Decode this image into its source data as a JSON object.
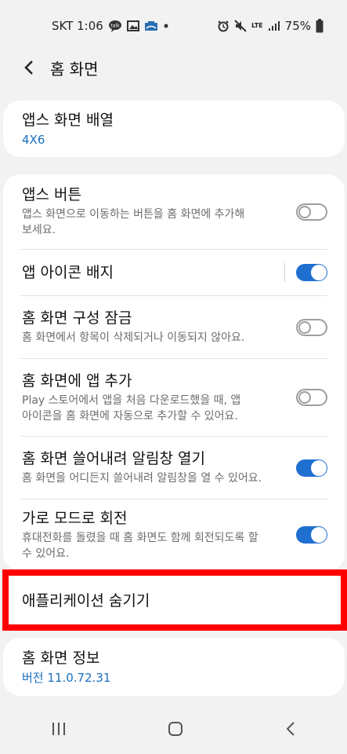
{
  "status": {
    "carrier_time": "SKT 1:06",
    "battery": "75%",
    "network": "LTE"
  },
  "header": {
    "title": "홈 화면"
  },
  "apps_layout": {
    "title": "앱스 화면 배열",
    "value": "4X6"
  },
  "settings": [
    {
      "title": "앱스 버튼",
      "desc": "앱스 화면으로 이동하는 버튼을 홈 화면에 추가해\n보세요.",
      "state": "off"
    },
    {
      "title": "앱 아이콘 배지",
      "desc": "",
      "state": "on"
    },
    {
      "title": "홈 화면 구성 잠금",
      "desc": "홈 화면에서 항목이 삭제되거나 이동되지 않아요.",
      "state": "off"
    },
    {
      "title": "홈 화면에 앱 추가",
      "desc": "Play 스토어에서 앱을 처음 다운로드했을 때, 앱\n아이콘을 홈 화면에 자동으로 추가할 수 있어요.",
      "state": "off"
    },
    {
      "title": "홈 화면 쓸어내려 알림창 열기",
      "desc": "홈 화면을 어디든지 쓸어내려 알림창을 열 수 있어요.",
      "state": "on"
    },
    {
      "title": "가로 모드로 회전",
      "desc": "휴대전화를 돌렸을 때 홈 화면도 함께 회전되도록 할\n수 있어요.",
      "state": "on"
    }
  ],
  "hide_apps": {
    "title": "애플리케이션 숨기기"
  },
  "about": {
    "title": "홈 화면 정보",
    "version": "버전 11.0.72.31"
  },
  "colors": {
    "accent": "#1f6fd1",
    "highlight": "#ff0000",
    "link": "#1a6fbf"
  }
}
